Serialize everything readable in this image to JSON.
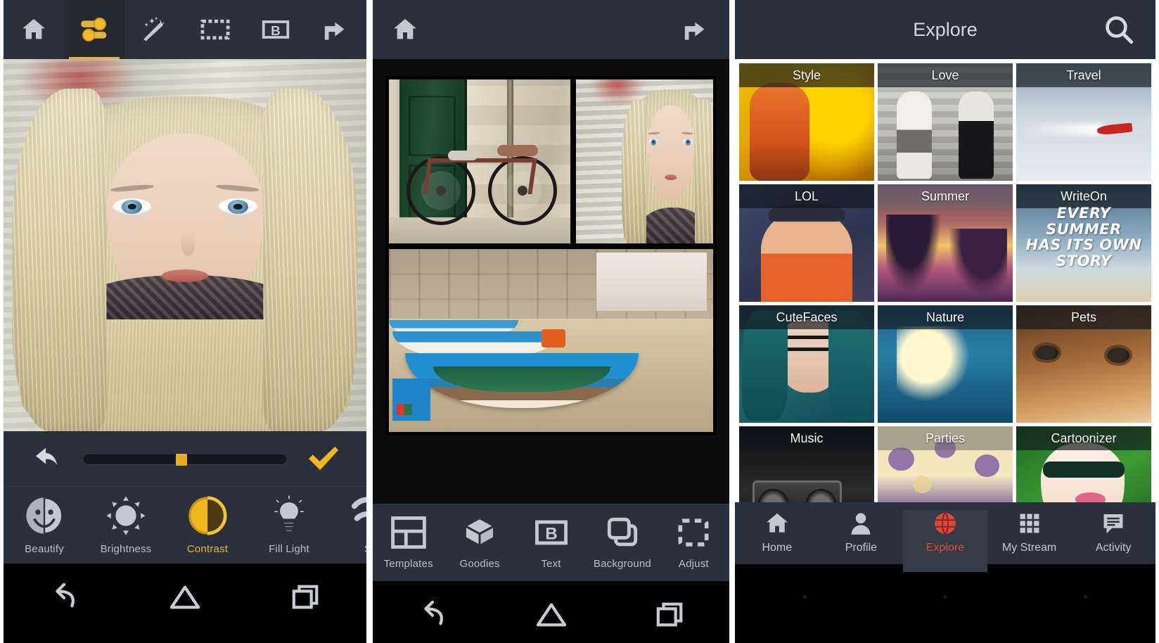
{
  "panel1": {
    "topbar": [
      {
        "name": "home-icon",
        "label": "Home",
        "active": false
      },
      {
        "name": "adjust-sliders-icon",
        "label": "Edit",
        "active": true
      },
      {
        "name": "magic-wand-icon",
        "label": "Effects",
        "active": false
      },
      {
        "name": "frame-icon",
        "label": "Frames",
        "active": false
      },
      {
        "name": "b-box-icon",
        "label": "Text",
        "active": false
      },
      {
        "name": "share-icon",
        "label": "Share",
        "active": false
      }
    ],
    "controls": {
      "undo_label": "Undo",
      "confirm_label": "Apply",
      "slider_value_percent": 46
    },
    "tools": [
      {
        "label": "Beautify",
        "icon": "beautify-face-icon",
        "selected": false
      },
      {
        "label": "Brightness",
        "icon": "sun-icon",
        "selected": false
      },
      {
        "label": "Contrast",
        "icon": "contrast-circle-icon",
        "selected": true
      },
      {
        "label": "Fill Light",
        "icon": "lightbulb-icon",
        "selected": false
      },
      {
        "label": "Sc",
        "icon": "partial-icon",
        "selected": false
      }
    ],
    "system_nav": [
      "back-icon",
      "home-icon",
      "recents-icon"
    ]
  },
  "panel2": {
    "topbar": [
      {
        "name": "home-icon",
        "label": "Home",
        "active": false
      },
      {
        "name": "share-icon",
        "label": "Share",
        "active": false
      }
    ],
    "collage": {
      "cells": [
        {
          "name": "collage-cell-bicycle",
          "caption": "Bicycle by green door"
        },
        {
          "name": "collage-cell-portrait",
          "caption": "Blonde girl portrait"
        },
        {
          "name": "collage-cell-boats",
          "caption": "Blue boats on beach"
        }
      ]
    },
    "tools": [
      {
        "label": "Templates",
        "icon": "grid-layout-icon"
      },
      {
        "label": "Goodies",
        "icon": "box-3d-icon"
      },
      {
        "label": "Text",
        "icon": "b-box-icon"
      },
      {
        "label": "Background",
        "icon": "layers-icon"
      },
      {
        "label": "Adjust",
        "icon": "crop-marquee-icon"
      }
    ],
    "system_nav": [
      "back-icon",
      "home-icon",
      "recents-icon"
    ]
  },
  "panel3": {
    "header": {
      "title": "Explore",
      "search_icon": "search-icon"
    },
    "tiles": [
      {
        "label": "Style",
        "art": "art-style",
        "cap": "dark"
      },
      {
        "label": "Love",
        "art": "art-love",
        "cap": "dark"
      },
      {
        "label": "Travel",
        "art": "art-travel",
        "cap": "dark"
      },
      {
        "label": "LOL",
        "art": "art-lol",
        "cap": "dark"
      },
      {
        "label": "Summer",
        "art": "art-summer",
        "cap": "light"
      },
      {
        "label": "WriteOn",
        "art": "art-writeon",
        "cap": "dark"
      },
      {
        "label": "CuteFaces",
        "art": "art-cute",
        "cap": "dark"
      },
      {
        "label": "Nature",
        "art": "art-nature",
        "cap": "dark"
      },
      {
        "label": "Pets",
        "art": "art-pets",
        "cap": "dark"
      },
      {
        "label": "Music",
        "art": "art-music",
        "cap": "dark"
      },
      {
        "label": "Parties",
        "art": "art-parties",
        "cap": "light"
      },
      {
        "label": "Cartoonizer",
        "art": "art-cartoon",
        "cap": "dark"
      }
    ],
    "writeon_overlay": [
      "EVERY SUMMER",
      "HAS ITS OWN",
      "STORY"
    ],
    "nav": [
      {
        "label": "Home",
        "icon": "home-icon",
        "active": false
      },
      {
        "label": "Profile",
        "icon": "person-icon",
        "active": false
      },
      {
        "label": "Explore",
        "icon": "globe-icon",
        "active": true
      },
      {
        "label": "My Stream",
        "icon": "grid-dots-icon",
        "active": false
      },
      {
        "label": "Activity",
        "icon": "comment-lines-icon",
        "active": false
      }
    ],
    "system_nav": [
      "back-icon",
      "home-icon",
      "recents-icon"
    ]
  },
  "colors": {
    "accent_yellow": "#e8b339",
    "toolbar_bg": "#2b313c",
    "active_red": "#e0483c",
    "icon_grey": "#c3c8d1"
  }
}
